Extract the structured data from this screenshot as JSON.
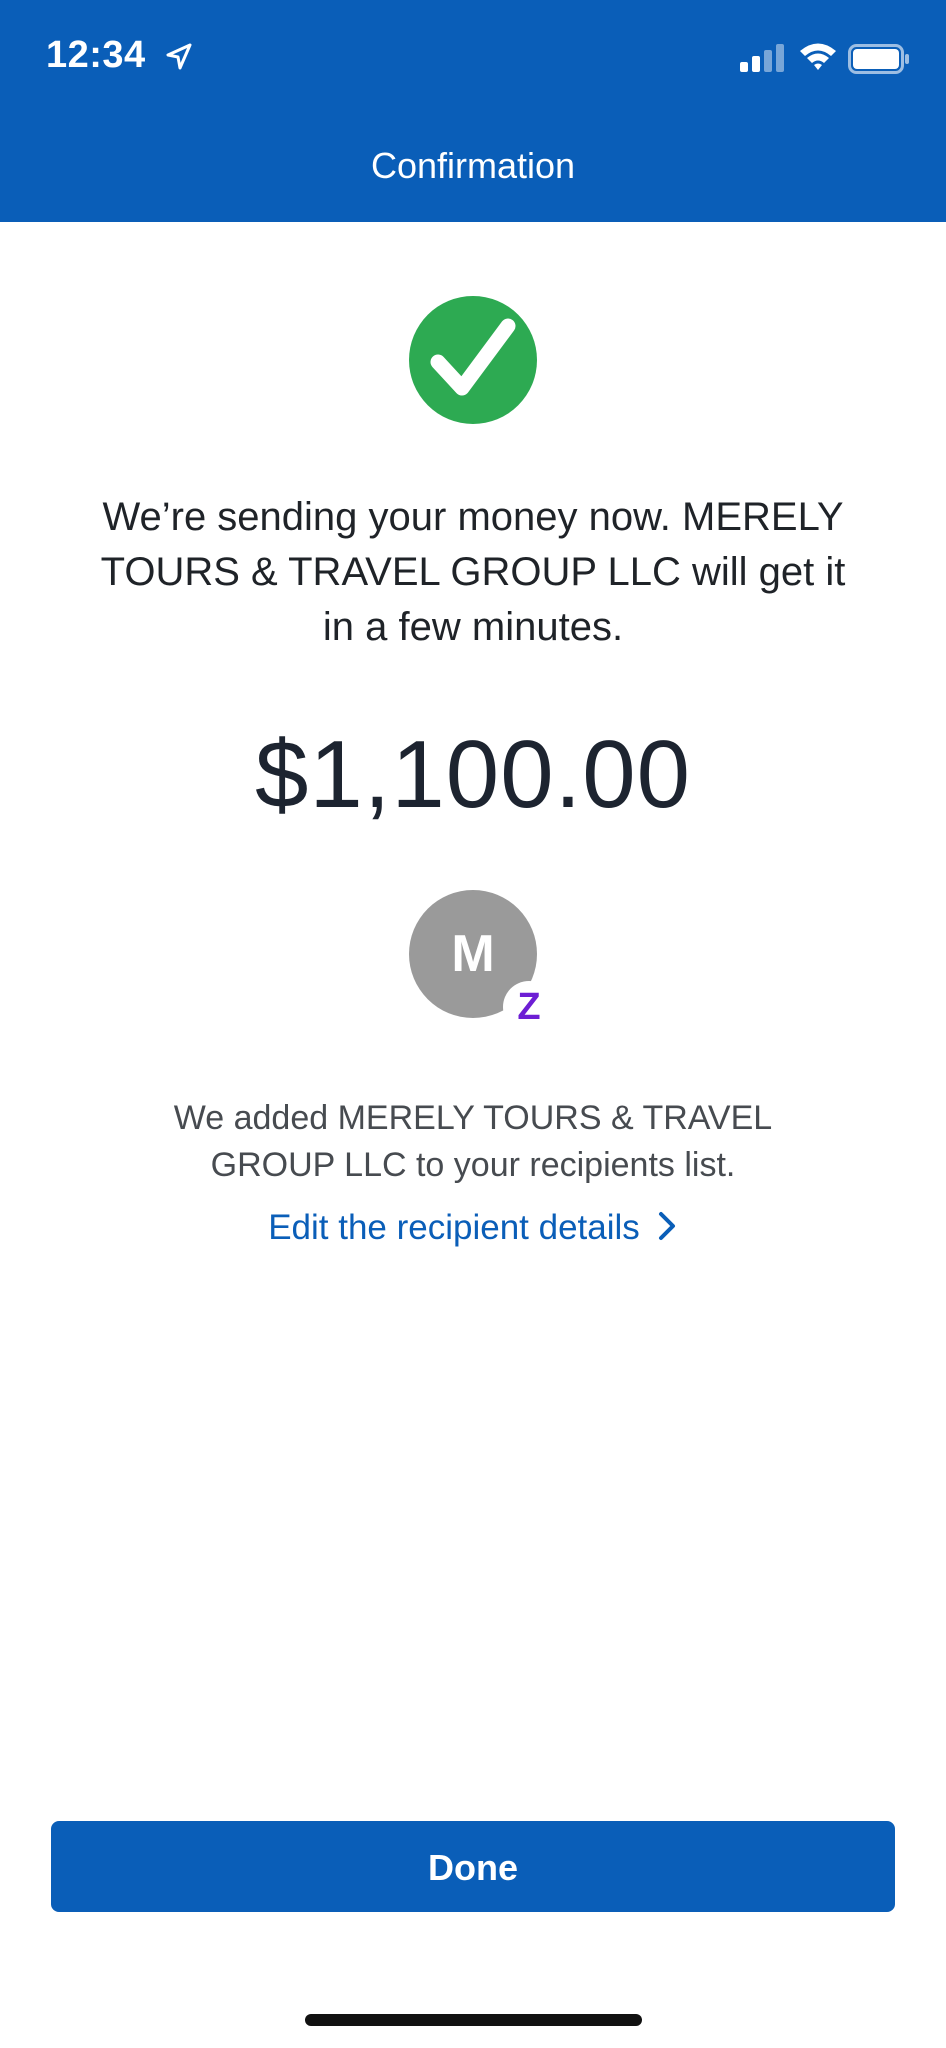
{
  "status_bar": {
    "time": "12:34",
    "icons": [
      "location-arrow-icon",
      "cellular-signal-icon",
      "wifi-icon",
      "battery-icon"
    ]
  },
  "header": {
    "title": "Confirmation"
  },
  "confirmation": {
    "icon": "checkmark-icon",
    "message": "We’re sending your money now. MERELY TOURS & TRAVEL GROUP LLC will get it in a few minutes.",
    "amount": "$1,100.00"
  },
  "recipient": {
    "initial": "M",
    "badge_letter": "Z",
    "badge_icon": "zelle-icon",
    "note": "We added MERELY TOURS & TRAVEL GROUP LLC to your recipients list.",
    "edit_link": "Edit the recipient details"
  },
  "footer": {
    "done_label": "Done"
  },
  "colors": {
    "brand_blue": "#0a5eb8",
    "success_green": "#2daa52",
    "zelle_purple": "#6d1ed4",
    "avatar_gray": "#9a9a9a"
  }
}
